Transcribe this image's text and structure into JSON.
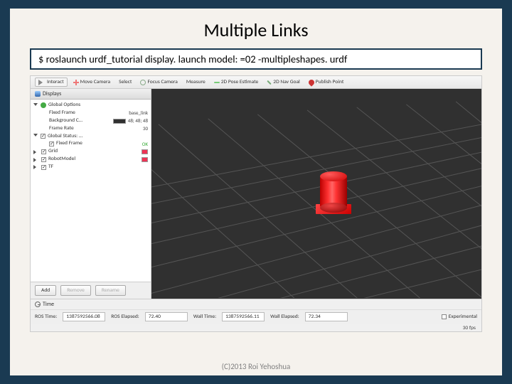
{
  "title": "Multiple Links",
  "command": "$ roslaunch urdf_tutorial display. launch model: =02 -multipleshapes. urdf",
  "footer": "(C)2013 Roi Yehoshua",
  "toolbar": {
    "interact": "Interact",
    "move_camera": "Move Camera",
    "select": "Select",
    "focus_camera": "Focus Camera",
    "measure": "Measure",
    "pose_estimate": "2D Pose Estimate",
    "nav_goal": "2D Nav Goal",
    "publish_point": "Publish Point"
  },
  "sidebar": {
    "header": "Displays",
    "global": {
      "label": "Global Options",
      "fixed_frame_lbl": "Fixed Frame",
      "fixed_frame_val": "base_link",
      "bg_lbl": "Background C…",
      "bg_val": "48; 48; 48",
      "frame_rate_lbl": "Frame Rate",
      "frame_rate_val": "30"
    },
    "global_status": {
      "label": "Global Status: …"
    },
    "global_status_item": {
      "label": "Fixed Frame",
      "val": "OK"
    },
    "items": {
      "grid": "Grid",
      "robot_model": "RobotModel",
      "tf": "TF"
    },
    "buttons": {
      "add": "Add",
      "remove": "Remove",
      "rename": "Rename"
    }
  },
  "time": {
    "header": "Time",
    "ros_time_lbl": "ROS Time:",
    "ros_time_val": "1387592566.08",
    "ros_elapsed_lbl": "ROS Elapsed:",
    "ros_elapsed_val": "72.40",
    "wall_time_lbl": "Wall Time:",
    "wall_time_val": "1387592566.11",
    "wall_elapsed_lbl": "Wall Elapsed:",
    "wall_elapsed_val": "72.34",
    "experimental": "Experimental",
    "fps": "30 fps"
  }
}
